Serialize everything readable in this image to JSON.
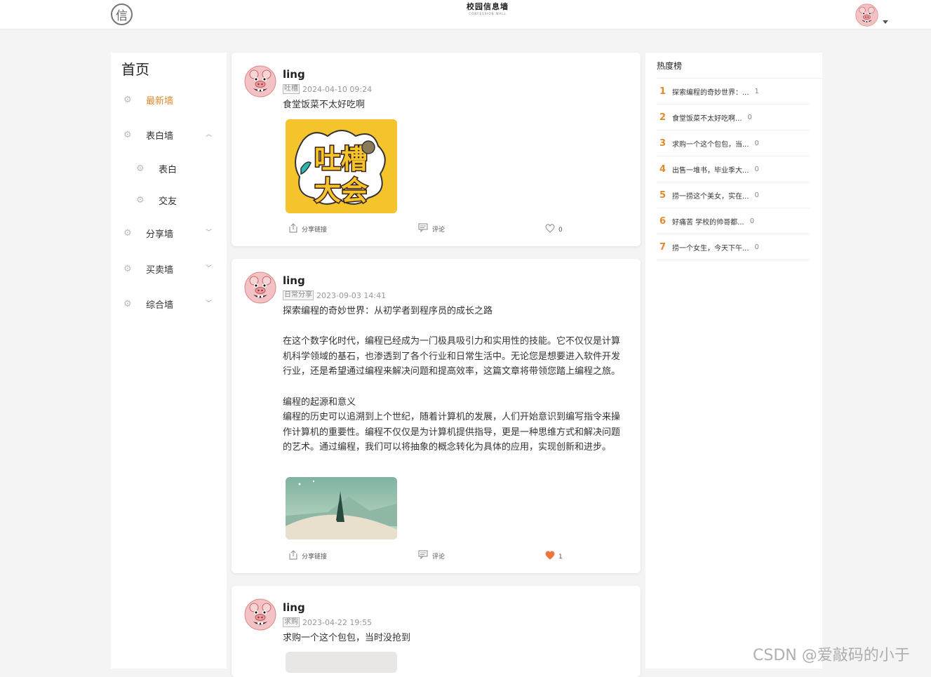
{
  "header": {
    "logo_char": "信",
    "brand_title": "校园信息墙",
    "brand_sub": "CONFESSION WALL"
  },
  "sidebar": {
    "home_title": "首页",
    "items": [
      {
        "label": "最新墙",
        "active": true
      },
      {
        "label": "表白墙",
        "expanded": true
      },
      {
        "label": "表白",
        "sub": true
      },
      {
        "label": "交友",
        "sub": true
      },
      {
        "label": "分享墙"
      },
      {
        "label": "买卖墙"
      },
      {
        "label": "综合墙"
      }
    ]
  },
  "posts": [
    {
      "author": "ling",
      "tag": "吐槽",
      "time": "2024-04-10 09:24",
      "content": "食堂饭菜不太好吃啊",
      "image_text_1": "吐槽",
      "image_text_2": "大会",
      "share_label": "分享链接",
      "comment_label": "评论",
      "like_count": "0",
      "liked": false
    },
    {
      "author": "ling",
      "tag": "日常分享",
      "time": "2023-09-03 14:41",
      "content": "探索编程的奇妙世界：从初学者到程序员的成长之路\n\n在这个数字化时代，编程已经成为一门极具吸引力和实用性的技能。它不仅仅是计算机科学领域的基石，也渗透到了各个行业和日常生活中。无论您是想要进入软件开发行业，还是希望通过编程来解决问题和提高效率，这篇文章将带领您踏上编程之旅。\n\n编程的起源和意义\n编程的历史可以追溯到上个世纪，随着计算机的发展，人们开始意识到编写指令来操作计算机的重要性。编程不仅仅是为计算机提供指导，更是一种思维方式和解决问题的艺术。通过编程，我们可以将抽象的概念转化为具体的应用，实现创新和进步。",
      "share_label": "分享链接",
      "comment_label": "评论",
      "like_count": "1",
      "liked": true
    },
    {
      "author": "ling",
      "tag": "求购",
      "time": "2023-04-22 19:55",
      "content": "求购一个这个包包，当时没抢到"
    }
  ],
  "hotlist": {
    "title": "热度榜",
    "items": [
      {
        "rank": "1",
        "text": "探索编程的奇妙世界：...",
        "count": "1"
      },
      {
        "rank": "2",
        "text": "食堂饭菜不太好吃啊...",
        "count": "0"
      },
      {
        "rank": "3",
        "text": "求购一个这个包包，当...",
        "count": "0"
      },
      {
        "rank": "4",
        "text": "出售一堆书，毕业季大...",
        "count": "0"
      },
      {
        "rank": "5",
        "text": "捞一捞这个美女，实在...",
        "count": "0"
      },
      {
        "rank": "6",
        "text": "好痛苦 学校的帅哥都...",
        "count": "0"
      },
      {
        "rank": "7",
        "text": "捞一个女生，今天下午...",
        "count": "0"
      }
    ]
  },
  "watermark": "CSDN @爱敲码的小于",
  "colors": {
    "accent": "#e08a2c",
    "like": "#f0743e"
  }
}
